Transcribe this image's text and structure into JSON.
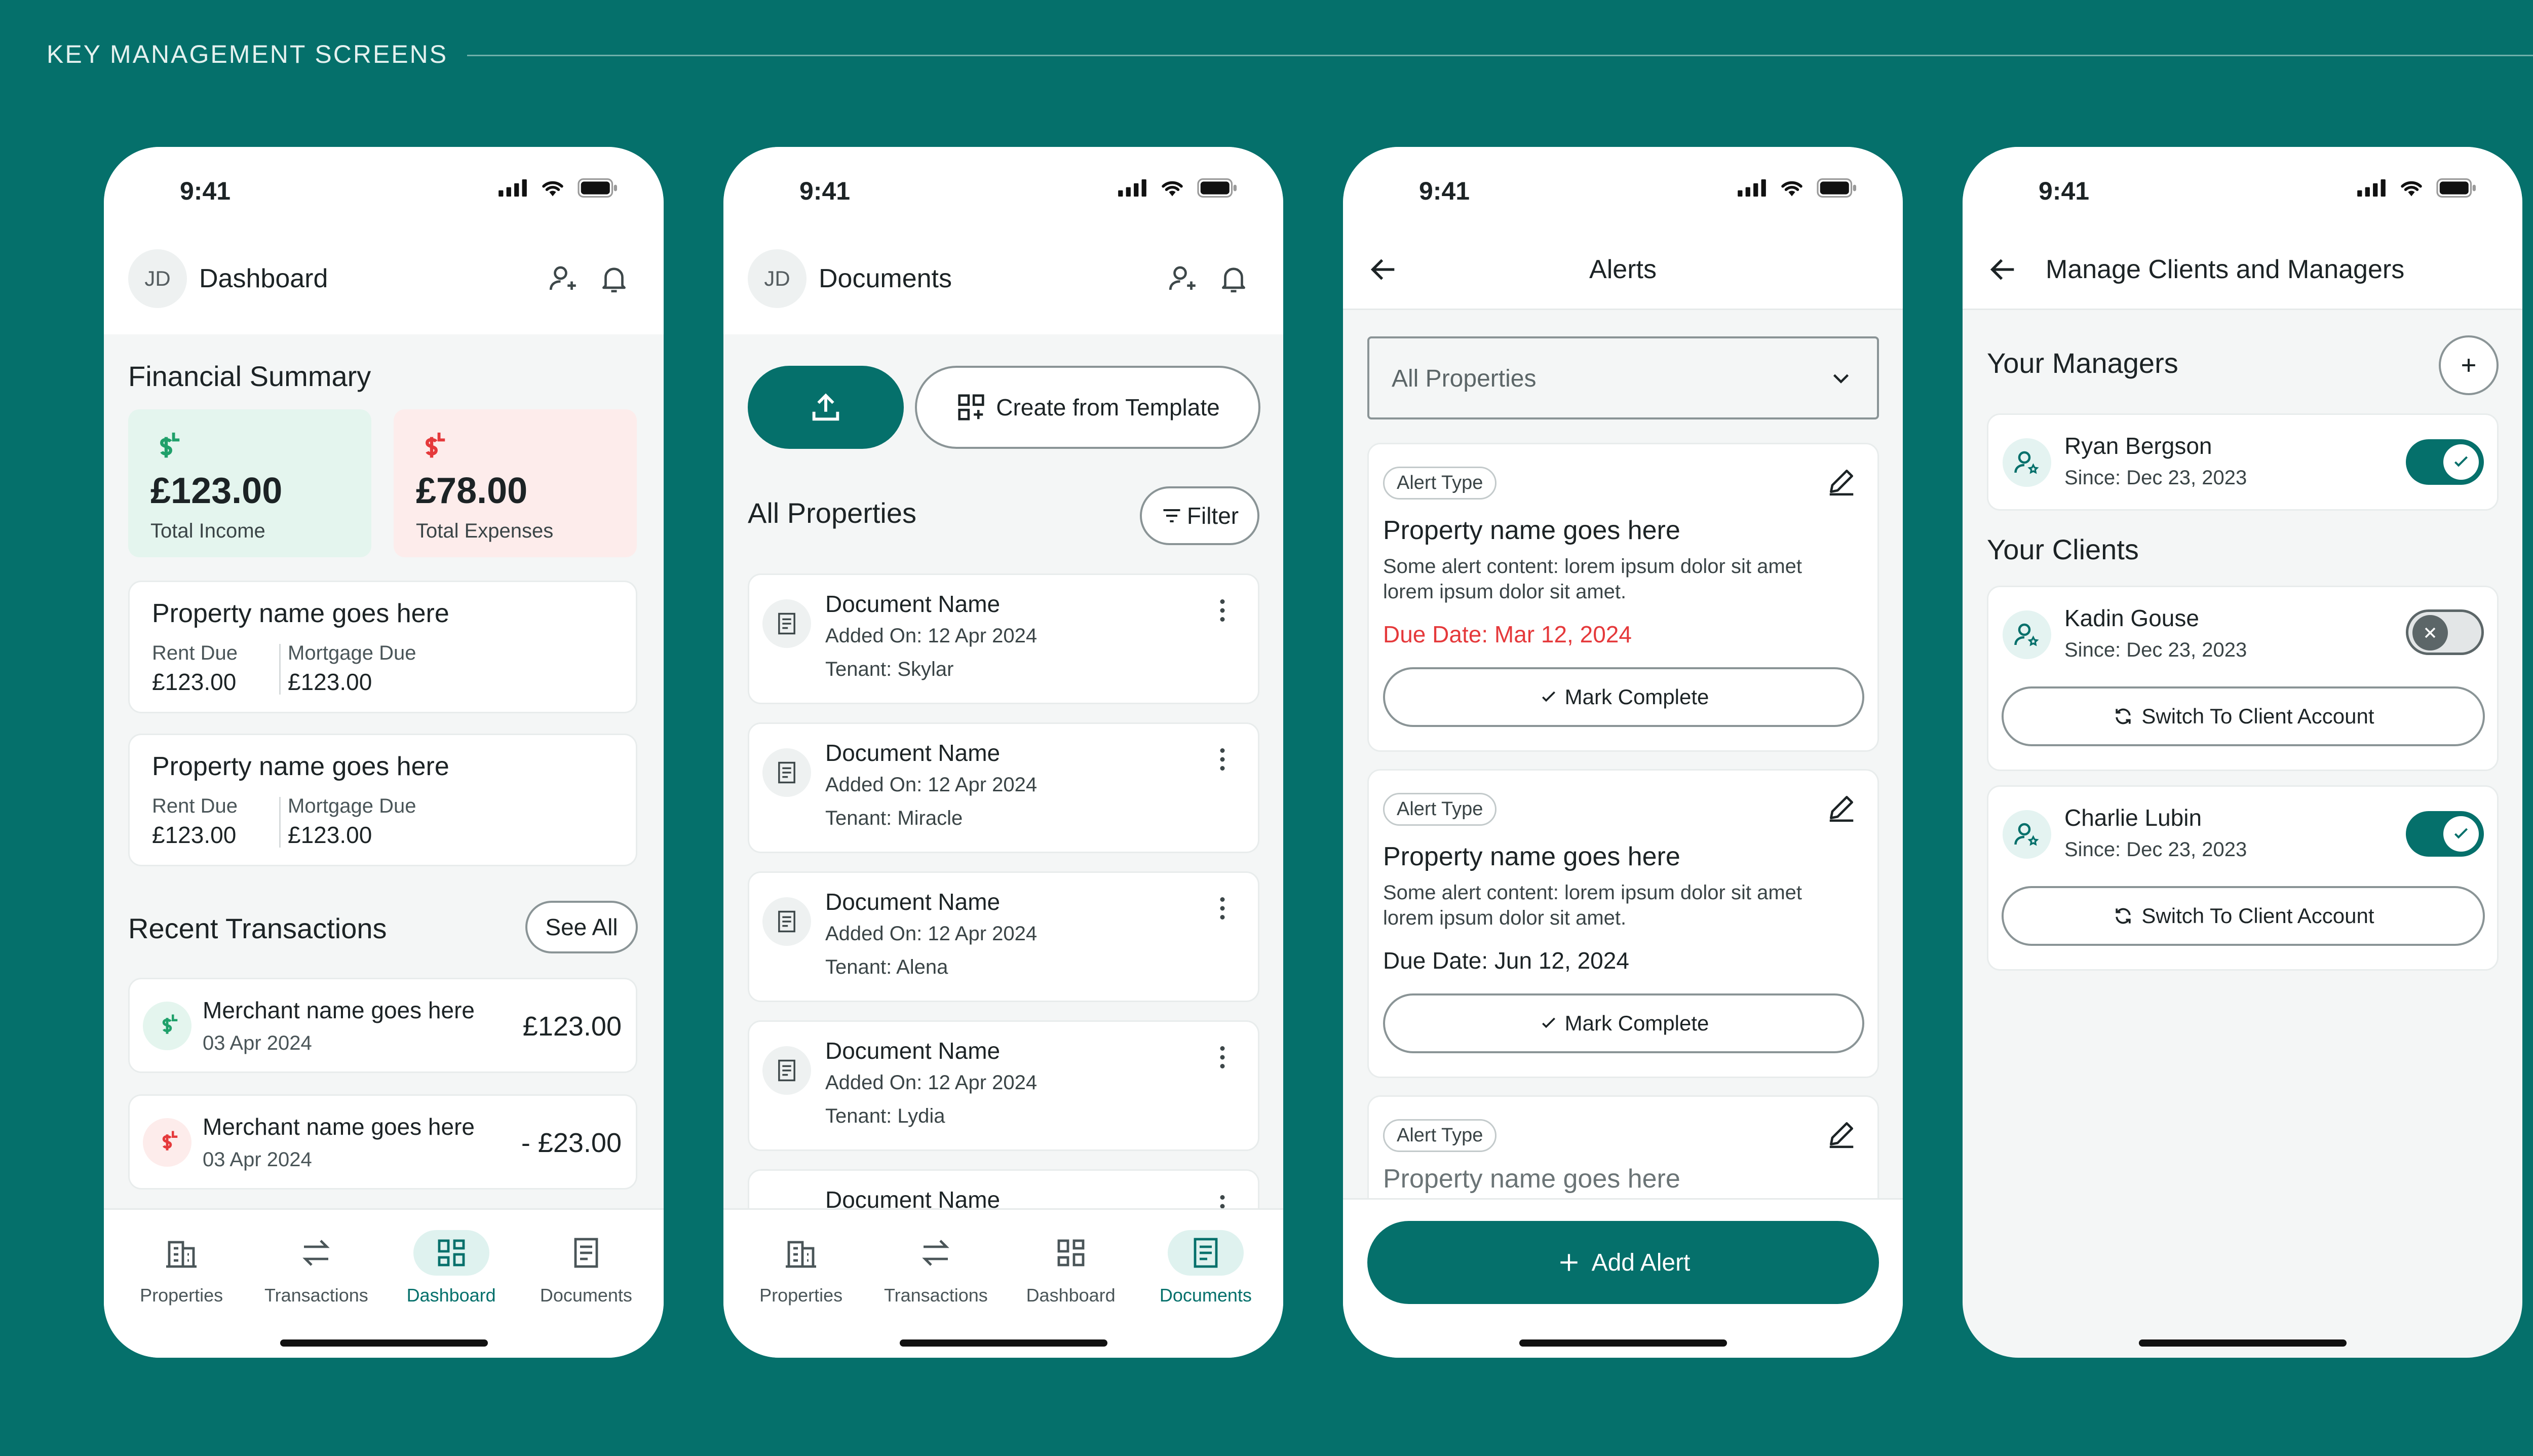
{
  "header": {
    "title": "KEY MANAGEMENT SCREENS"
  },
  "status_time": "9:41",
  "colors": {
    "background": "#05706b",
    "accent": "#05706b",
    "income_bg": "#e4f5ee",
    "expense_bg": "#fdeceb",
    "danger": "#e5393b",
    "success": "#1fa06a"
  },
  "nav": {
    "properties": "Properties",
    "transactions": "Transactions",
    "dashboard": "Dashboard",
    "documents": "Documents"
  },
  "dashboard": {
    "avatar": "JD",
    "title": "Dashboard",
    "financial_summary": "Financial Summary",
    "income": {
      "amount": "£123.00",
      "label": "Total Income"
    },
    "expenses": {
      "amount": "£78.00",
      "label": "Total Expenses"
    },
    "properties": [
      {
        "name": "Property name goes here",
        "rent_label": "Rent Due",
        "rent": "£123.00",
        "mortgage_label": "Mortgage Due",
        "mortgage": "£123.00"
      },
      {
        "name": "Property name goes here",
        "rent_label": "Rent Due",
        "rent": "£123.00",
        "mortgage_label": "Mortgage Due",
        "mortgage": "£123.00"
      }
    ],
    "recent_transactions": "Recent Transactions",
    "see_all": "See All",
    "transactions": [
      {
        "merchant": "Merchant name goes here",
        "date": "03 Apr 2024",
        "amount": "£123.00",
        "kind": "income"
      },
      {
        "merchant": "Merchant name goes here",
        "date": "03 Apr 2024",
        "amount": "- £23.00",
        "kind": "expense"
      }
    ]
  },
  "documents": {
    "avatar": "JD",
    "title": "Documents",
    "create_template": "Create from Template",
    "all_properties": "All Properties",
    "filter": "Filter",
    "items": [
      {
        "name": "Document Name",
        "added": "Added On: 12 Apr 2024",
        "tenant": "Tenant: Skylar"
      },
      {
        "name": "Document Name",
        "added": "Added On: 12 Apr 2024",
        "tenant": "Tenant: Miracle"
      },
      {
        "name": "Document Name",
        "added": "Added On: 12 Apr 2024",
        "tenant": "Tenant: Alena"
      },
      {
        "name": "Document Name",
        "added": "Added On: 12 Apr 2024",
        "tenant": "Tenant: Lydia"
      },
      {
        "name": "Document Name"
      }
    ]
  },
  "alerts": {
    "title": "Alerts",
    "select_value": "All Properties",
    "items": [
      {
        "type": "Alert Type",
        "property": "Property name goes here",
        "content": "Some alert content: lorem ipsum dolor sit amet lorem ipsum dolor sit amet.",
        "due": "Due Date: Mar 12, 2024",
        "overdue": true,
        "action": "Mark Complete"
      },
      {
        "type": "Alert Type",
        "property": "Property name goes here",
        "content": "Some alert content: lorem ipsum dolor sit amet lorem ipsum dolor sit amet.",
        "due": "Due Date: Jun 12, 2024",
        "overdue": false,
        "action": "Mark Complete"
      },
      {
        "type": "Alert Type",
        "property": "Property name goes here"
      }
    ],
    "add_alert": "Add Alert"
  },
  "clients": {
    "title": "Manage Clients and Managers",
    "your_managers": "Your Managers",
    "managers": [
      {
        "name": "Ryan Bergson",
        "since": "Since: Dec 23, 2023",
        "enabled": true
      }
    ],
    "your_clients": "Your Clients",
    "clients": [
      {
        "name": "Kadin Gouse",
        "since": "Since: Dec 23, 2023",
        "enabled": false,
        "action": "Switch To Client Account"
      },
      {
        "name": "Charlie Lubin",
        "since": "Since: Dec 23, 2023",
        "enabled": true,
        "action": "Switch To Client Account"
      }
    ]
  }
}
